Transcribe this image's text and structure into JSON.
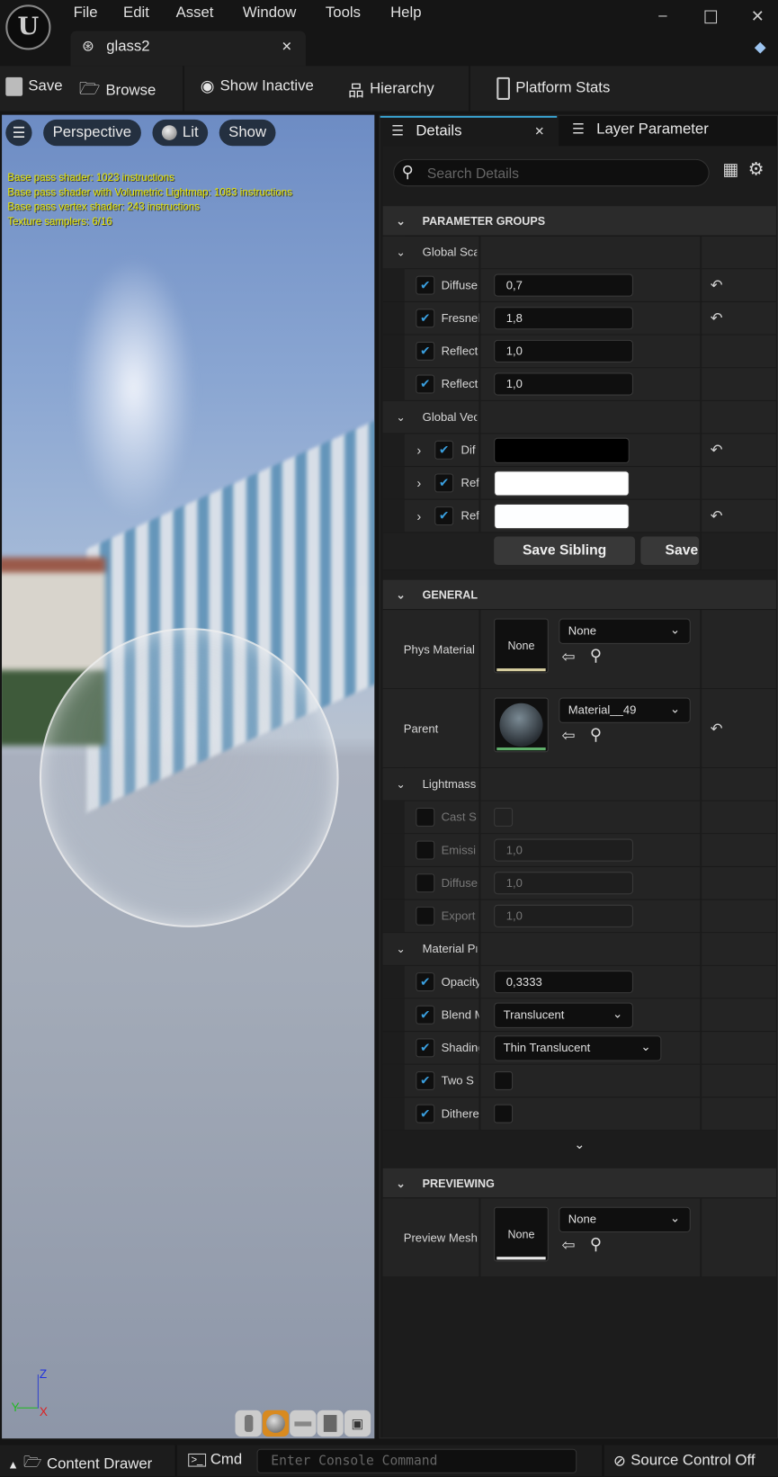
{
  "titlebar": {
    "menu": [
      "File",
      "Edit",
      "Asset",
      "Window",
      "Tools",
      "Help"
    ],
    "tab": "glass2"
  },
  "toolbar": {
    "save": "Save",
    "browse": "Browse",
    "show_inactive": "Show Inactive",
    "hierarchy": "Hierarchy",
    "platform_stats": "Platform Stats"
  },
  "viewport": {
    "perspective": "Perspective",
    "lit": "Lit",
    "show": "Show",
    "stats": [
      "Base pass shader: 1023 instructions",
      "Base pass shader with Volumetric Lightmap: 1083 instructions",
      "Base pass vertex shader: 243 instructions",
      "Texture samplers: 6/16"
    ],
    "axes": {
      "z": "Z",
      "y": "Y",
      "x": "X"
    }
  },
  "details": {
    "tab_details": "Details",
    "tab_layer": "Layer Parameter",
    "search_placeholder": "Search Details",
    "sections": [
      {
        "title": "PARAMETER GROUPS",
        "groups": [
          {
            "title": "Global Sca",
            "rows": [
              {
                "type": "number",
                "label": "Diffuse",
                "checked": true,
                "value": "0,7",
                "reset": true
              },
              {
                "type": "number",
                "label": "Fresnel",
                "checked": true,
                "value": "1,8",
                "reset": true
              },
              {
                "type": "number",
                "label": "Reflect",
                "checked": true,
                "value": "1,0",
                "reset": false
              },
              {
                "type": "number",
                "label": "Reflect",
                "checked": true,
                "value": "1,0",
                "reset": false
              }
            ]
          },
          {
            "title": "Global Vec",
            "rows": [
              {
                "type": "color",
                "label": "Dif",
                "checked": true,
                "color": "#000000",
                "reset": true
              },
              {
                "type": "color",
                "label": "Ref",
                "checked": true,
                "color": "#ffffff",
                "reset": false
              },
              {
                "type": "color",
                "label": "Ref",
                "checked": true,
                "color": "#fdfeff",
                "reset": true
              }
            ]
          }
        ],
        "buttons": [
          "Save Sibling",
          "Save Child"
        ]
      },
      {
        "title": "GENERAL",
        "assets": [
          {
            "label": "Phys Material",
            "thumb": "None",
            "value": "None",
            "reset": false,
            "accent": "#d8cfa0"
          },
          {
            "label": "Parent",
            "thumb": "",
            "value": "Material__49",
            "reset": true,
            "accent": "#5fae6a"
          }
        ],
        "groups": [
          {
            "title": "Lightmass",
            "rows": [
              {
                "type": "check",
                "label": "Cast S",
                "checked": false,
                "disabled": true
              },
              {
                "type": "number",
                "label": "Emissi",
                "checked": false,
                "value": "1,0",
                "disabled": true
              },
              {
                "type": "number",
                "label": "Diffuse",
                "checked": false,
                "value": "1,0",
                "disabled": true
              },
              {
                "type": "number",
                "label": "Export",
                "checked": false,
                "value": "1,0",
                "disabled": true
              }
            ]
          },
          {
            "title": "Material Pr",
            "rows": [
              {
                "type": "number",
                "label": "Opacity",
                "checked": true,
                "value": "0,3333"
              },
              {
                "type": "dropdown",
                "label": "Blend Mode",
                "checked": true,
                "value": "Translucent"
              },
              {
                "type": "dropdown",
                "label": "Shading",
                "checked": true,
                "value": "Thin Translucent",
                "wide": true
              },
              {
                "type": "check",
                "label": "Two S",
                "checked": true
              },
              {
                "type": "check",
                "label": "Dithered",
                "checked": true
              }
            ]
          }
        ]
      },
      {
        "title": "PREVIEWING",
        "assets": [
          {
            "label": "Preview Mesh",
            "thumb": "None",
            "value": "None",
            "reset": false,
            "accent": "#e8e8e8"
          }
        ]
      }
    ]
  },
  "statusbar": {
    "content_drawer": "Content Drawer",
    "cmd": "Cmd",
    "console_placeholder": "Enter Console Command",
    "source_control": "Source Control Off"
  }
}
